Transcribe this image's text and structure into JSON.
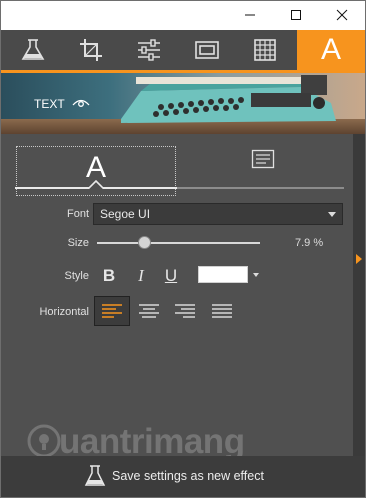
{
  "window": {
    "controls": [
      "minimize",
      "maximize",
      "close"
    ]
  },
  "toolbar": {
    "tools": [
      {
        "icon": "flask-icon"
      },
      {
        "icon": "crop-icon"
      },
      {
        "icon": "sliders-icon"
      },
      {
        "icon": "frame-icon"
      },
      {
        "icon": "texture-icon"
      },
      {
        "icon": "text-icon",
        "label": "A",
        "active": true
      }
    ],
    "accent_color": "#f7941e"
  },
  "banner": {
    "title": "TEXT",
    "eye_icon": "eye-icon"
  },
  "tabs": {
    "text_tab": "A",
    "paragraph_tab_icon": "paragraph-icon"
  },
  "controls": {
    "font_label": "Font",
    "font_value": "Segoe UI",
    "size_label": "Size",
    "size_value": "7.9 %",
    "style_label": "Style",
    "bold": "B",
    "italic": "I",
    "underline": "U",
    "color_value": "#ffffff",
    "horizontal_label": "Horizontal"
  },
  "bottom": {
    "save_label": "Save settings as new effect"
  },
  "watermark": {
    "text": "uantrimang"
  }
}
